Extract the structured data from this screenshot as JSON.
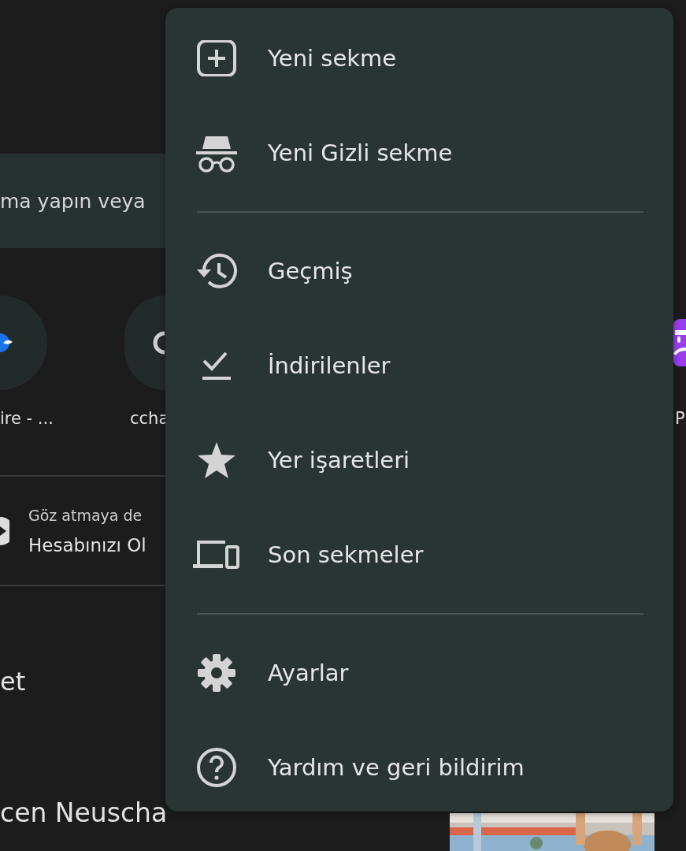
{
  "page": {
    "search": {
      "placeholder": "ma yapın veya"
    },
    "shortcuts": [
      {
        "label": "ire - ..."
      },
      {
        "label": "ccha"
      },
      {
        "label": "P"
      }
    ],
    "sign_in": {
      "line_1": "Göz atmaya de",
      "line_2": "Hesabınızı Ol"
    },
    "section_title": "et",
    "article": {
      "title": "cen Neuscha"
    }
  },
  "menu": {
    "items": [
      {
        "kind": "item",
        "label": "Yeni sekme"
      },
      {
        "kind": "item",
        "label": "Yeni Gizli sekme"
      },
      {
        "kind": "divider"
      },
      {
        "kind": "item",
        "label": "Geçmiş"
      },
      {
        "kind": "item",
        "label": "İndirilenler"
      },
      {
        "kind": "item",
        "label": "Yer işaretleri"
      },
      {
        "kind": "item",
        "label": "Son sekmeler"
      },
      {
        "kind": "divider"
      },
      {
        "kind": "item",
        "label": "Ayarlar"
      },
      {
        "kind": "item",
        "label": "Yardım ve geri bildirim"
      }
    ]
  }
}
